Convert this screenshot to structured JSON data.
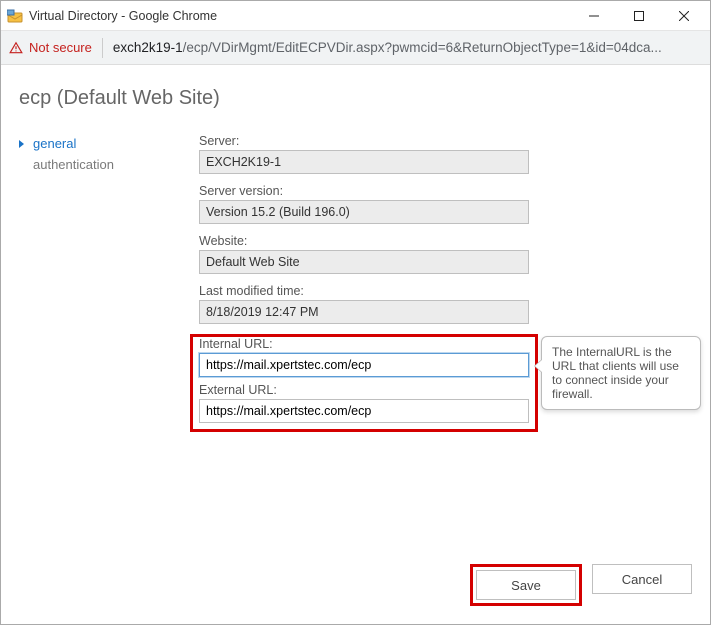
{
  "window": {
    "title": "Virtual Directory - Google Chrome"
  },
  "addressbar": {
    "security_label": "Not secure",
    "url_host": "exch2k19-1",
    "url_rest": "/ecp/VDirMgmt/EditECPVDir.aspx?pwmcid=6&ReturnObjectType=1&id=04dca..."
  },
  "page": {
    "title": "ecp (Default Web Site)"
  },
  "sidebar": {
    "items": [
      {
        "label": "general",
        "selected": true
      },
      {
        "label": "authentication",
        "selected": false
      }
    ]
  },
  "form": {
    "server_label": "Server:",
    "server_value": "EXCH2K19-1",
    "version_label": "Server version:",
    "version_value": "Version 15.2 (Build 196.0)",
    "website_label": "Website:",
    "website_value": "Default Web Site",
    "modified_label": "Last modified time:",
    "modified_value": "8/18/2019 12:47 PM",
    "internal_label": "Internal URL:",
    "internal_value": "https://mail.xpertstec.com/ecp",
    "external_label": "External URL:",
    "external_value": "https://mail.xpertstec.com/ecp"
  },
  "tooltip": {
    "text": "The InternalURL is the URL that clients will use to connect inside your firewall."
  },
  "footer": {
    "save": "Save",
    "cancel": "Cancel"
  }
}
